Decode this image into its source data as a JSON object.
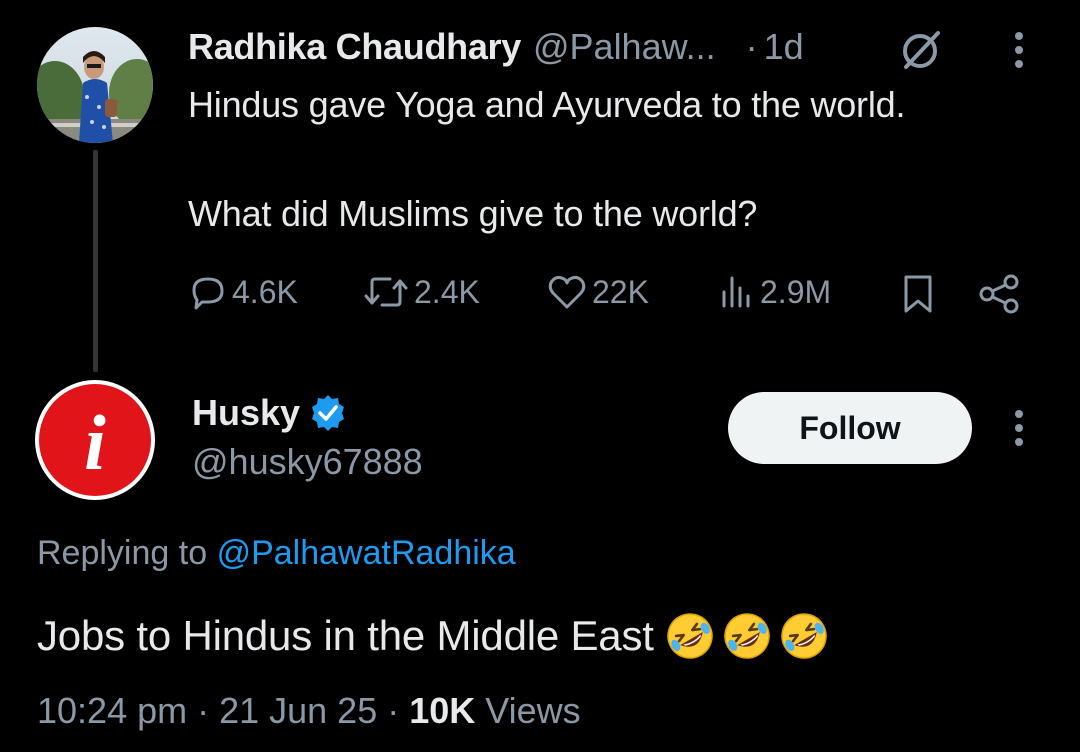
{
  "parent_tweet": {
    "author_name": "Radhika Chaudhary",
    "author_handle": "@Palhaw...",
    "separator": "·",
    "time": "1d",
    "line1": "Hindus gave Yoga and Ayurveda to the world.",
    "line2": "What did Muslims give to the world?",
    "metrics": {
      "replies": "4.6K",
      "retweets": "2.4K",
      "likes": "22K",
      "views": "2.9M"
    }
  },
  "reply_tweet": {
    "author_name": "Husky",
    "author_handle": "@husky67888",
    "avatar_letter": "i",
    "follow_label": "Follow",
    "replying_to_prefix": "Replying to",
    "replying_to_handle": "@PalhawatRadhika",
    "text": "Jobs to Hindus in the Middle East",
    "emojis": [
      "rolling-on-floor-laughing",
      "rolling-on-floor-laughing",
      "rolling-on-floor-laughing"
    ],
    "timestamp": "10:24 pm · 21 Jun 25 ·",
    "views_count": "10K",
    "views_label": "Views"
  },
  "colors": {
    "background": "#000000",
    "text_primary": "#e7e9ea",
    "text_secondary": "#8b98a5",
    "link": "#1d9bf0",
    "verified": "#1d9bf0",
    "avatar_red": "#e1141a"
  },
  "icons": [
    "grok-icon",
    "more-icon",
    "reply-icon",
    "retweet-icon",
    "like-icon",
    "views-icon",
    "bookmark-icon",
    "share-icon",
    "verified-badge-icon"
  ]
}
